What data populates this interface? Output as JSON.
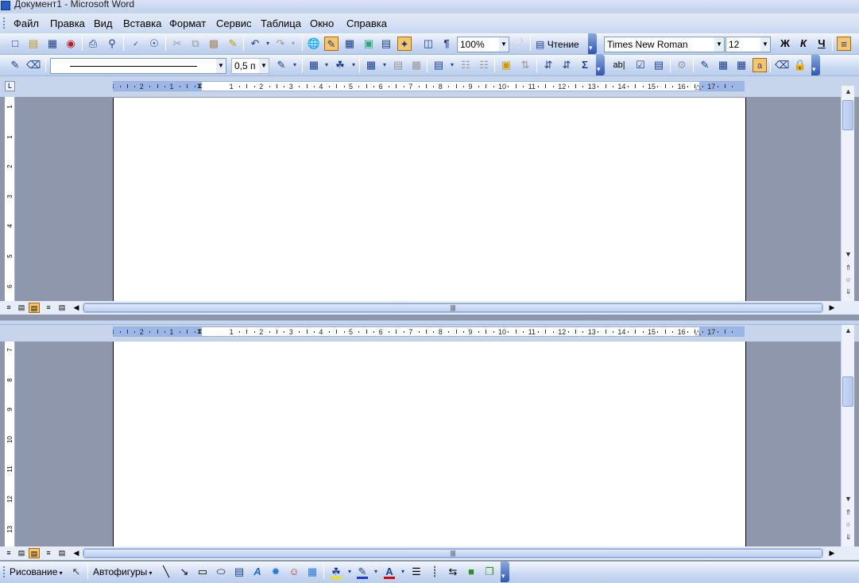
{
  "window": {
    "title": "Документ1 - Microsoft Word"
  },
  "menu": [
    "Файл",
    "Правка",
    "Вид",
    "Вставка",
    "Формат",
    "Сервис",
    "Таблица",
    "Окно",
    "Справка"
  ],
  "standard_toolbar": {
    "zoom": "100%",
    "reading_label": "Чтение",
    "icons": [
      "new-icon",
      "open-icon",
      "save-icon",
      "permission-icon",
      "print-icon",
      "print-preview-icon",
      "spelling-icon",
      "research-icon",
      "cut-icon",
      "copy-icon",
      "paste-icon",
      "format-painter-icon",
      "undo-icon",
      "redo-icon",
      "hyperlink-icon",
      "tables-borders-icon",
      "insert-table-icon",
      "insert-excel-icon",
      "columns-icon",
      "drawing-icon",
      "document-map-icon",
      "show-hide-icon",
      "help-icon"
    ]
  },
  "format_toolbar": {
    "font": "Times New Roman",
    "size": "12",
    "bold": "Ж",
    "italic": "К",
    "underline": "Ч"
  },
  "tables_toolbar": {
    "line_weight": "0,5 п",
    "autosum": "Σ",
    "text_form_field": "ab|"
  },
  "ruler": {
    "labels": [
      "3",
      "2",
      "1",
      "1",
      "2",
      "3",
      "4",
      "5",
      "6",
      "7",
      "8",
      "9",
      "10",
      "11",
      "12",
      "13",
      "14",
      "15",
      "16",
      "17"
    ],
    "vertical_top": [
      "1",
      "1",
      "2",
      "3",
      "4",
      "5",
      "6"
    ],
    "vertical_bottom": [
      "7",
      "8",
      "9",
      "10",
      "11",
      "12",
      "13"
    ],
    "tab_selector": "L"
  },
  "drawing_toolbar": {
    "draw_label": "Рисование",
    "autoshapes_label": "Автофигуры"
  },
  "colors": {
    "fill": "#f2e400",
    "line": "#1f3fd0",
    "font": "#e00000"
  }
}
